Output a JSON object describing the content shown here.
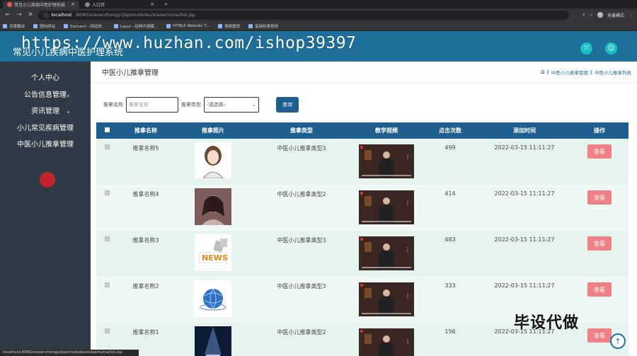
{
  "browser": {
    "tabs": [
      {
        "label": "常见小儿疾病中医护理系统",
        "active": true
      },
      {
        "label": "入口页",
        "active": false
      }
    ],
    "new_tab": "+",
    "url_host": "localhost",
    "url_path": ":8080/xiaoerzhongyi/jsp/modules/xiaoertuina/list.jsp",
    "profile_label": "无痕模式",
    "bookmarks": [
      "百度翻译",
      "图标网站",
      "Element - 网站快...",
      "Layui - 经典开源模...",
      "HTML5 Website T...",
      "搜索壁纸",
      "基础检索规则"
    ]
  },
  "header": {
    "title": "常见小儿疾病中医护理系统",
    "watermark": "https://www.huzhan.com/ishop39397"
  },
  "sidebar": {
    "items": [
      "个人中心",
      "公告信息管理",
      "资讯管理",
      "小儿常见疾病管理",
      "中医小儿推拿管理"
    ]
  },
  "main": {
    "page_title": "中医小儿推拿管理",
    "breadcrumb": [
      "中医小儿推拿管理",
      "中医小儿推拿列表"
    ],
    "breadcrumb_sep": "‖",
    "search": {
      "name_label": "推拿名称",
      "name_placeholder": "推拿名称",
      "type_label": "推拿类型",
      "type_selected": "-请选择-",
      "button": "查询"
    },
    "table": {
      "headers": [
        "推拿名称",
        "推拿照片",
        "推拿类型",
        "教学视频",
        "点击次数",
        "添加时间",
        "操作"
      ],
      "rows": [
        {
          "name": "推拿名称5",
          "photo": "girl",
          "type": "中医小儿推拿类型3",
          "clicks": "499",
          "time": "2022-03-15 11:11:27",
          "action": "查看"
        },
        {
          "name": "推拿名称4",
          "photo": "woman",
          "type": "中医小儿推拿类型2",
          "clicks": "414",
          "time": "2022-03-15 11:11:27",
          "action": "查看"
        },
        {
          "name": "推拿名称3",
          "photo": "news",
          "type": "中医小儿推拿类型3",
          "clicks": "483",
          "time": "2022-03-15 11:11:27",
          "action": "查看"
        },
        {
          "name": "推拿名称2",
          "photo": "globe",
          "type": "中医小儿推拿类型3",
          "clicks": "333",
          "time": "2022-03-15 11:11:27",
          "action": "查看"
        },
        {
          "name": "推拿名称1",
          "photo": "stage",
          "type": "中医小儿推拿类型2",
          "clicks": "156",
          "time": "2022-03-15 11:11:27",
          "action": "查看"
        }
      ]
    }
  },
  "watermark_cn": "毕设代做",
  "status_url": "localhost:8080/xiaoerzhongyi/jsp/modules/xiaoertuina/list.jsp",
  "colors": {
    "header": "#1f6f9b",
    "sidebar": "#2f3b44",
    "table_head": "#1f5f8f",
    "view_button": "#f07f86"
  }
}
